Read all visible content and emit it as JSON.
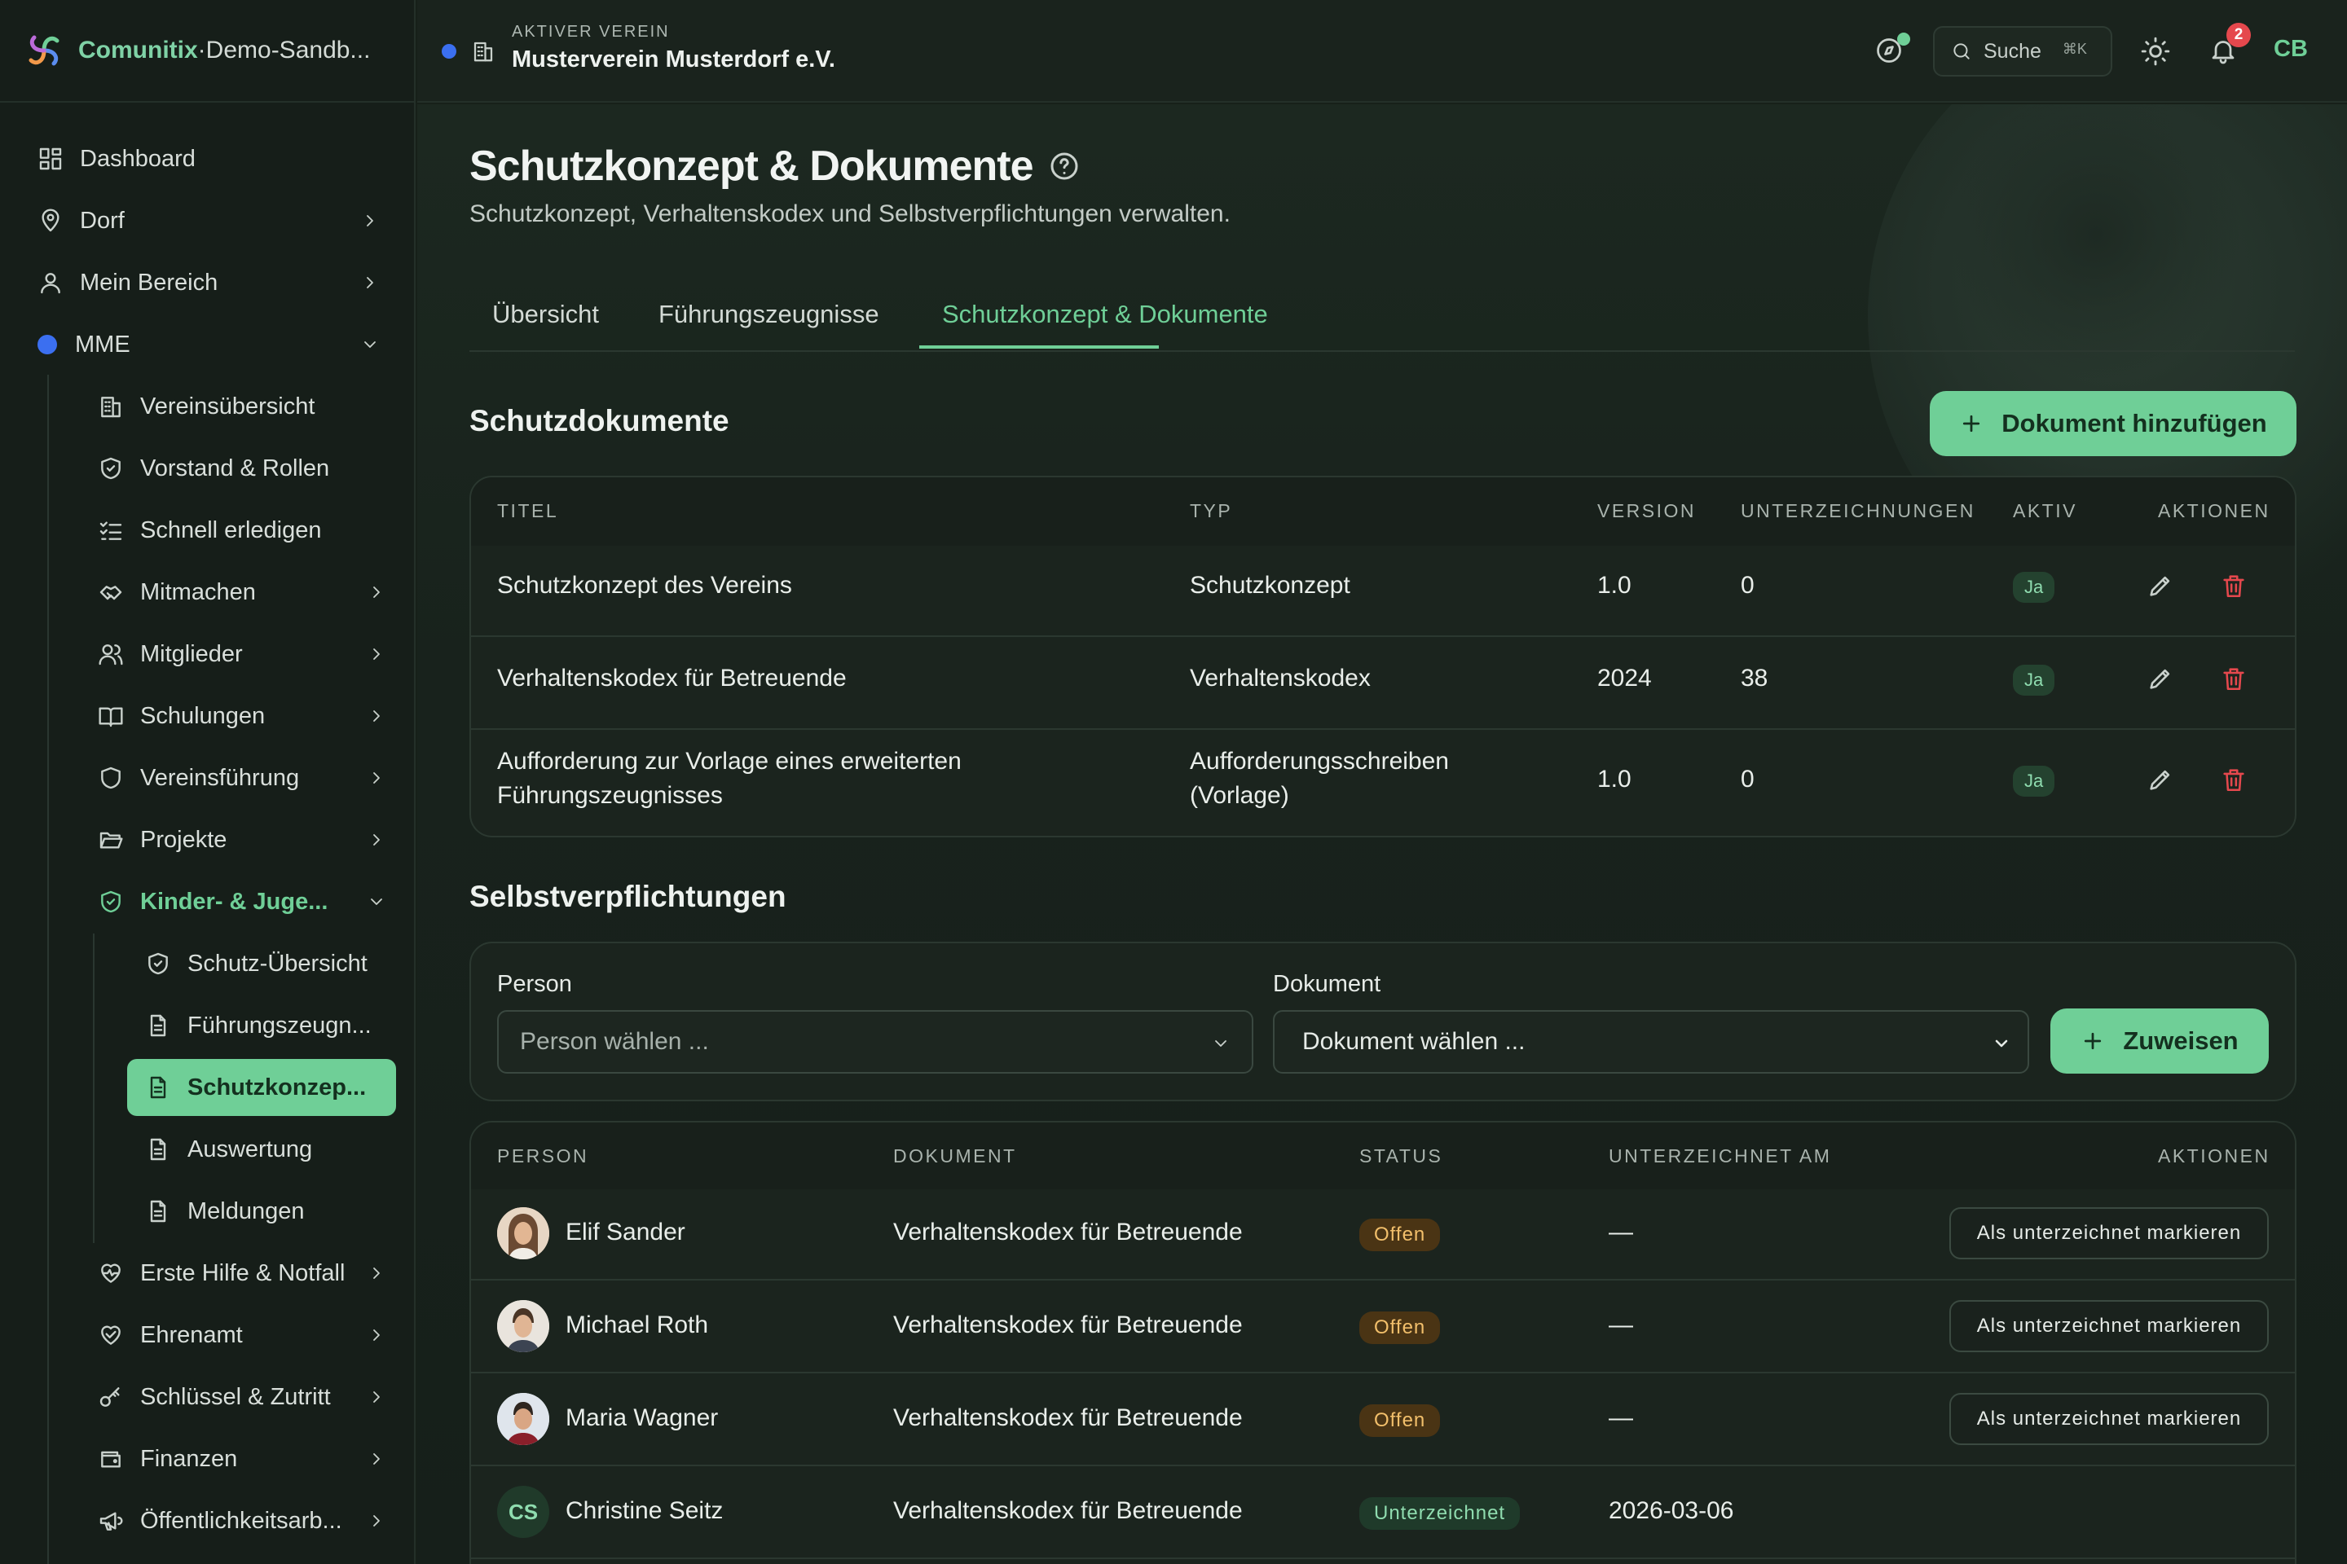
{
  "brand": {
    "name": "Comunitix",
    "separator": " · ",
    "sandbox": "Demo-Sandb..."
  },
  "topbar": {
    "org_label": "AKTIVER VEREIN",
    "org_name": "Musterverein Musterdorf e.V.",
    "search_label": "Suche",
    "search_shortcut": "⌘K",
    "notification_count": "2",
    "user_initials": "CB"
  },
  "sidebar": {
    "items": [
      {
        "label": "Dashboard"
      },
      {
        "label": "Dorf"
      },
      {
        "label": "Mein Bereich"
      },
      {
        "label": "MME"
      },
      {
        "label": "Vereinsübersicht"
      },
      {
        "label": "Vorstand & Rollen"
      },
      {
        "label": "Schnell erledigen"
      },
      {
        "label": "Mitmachen"
      },
      {
        "label": "Mitglieder"
      },
      {
        "label": "Schulungen"
      },
      {
        "label": "Vereinsführung"
      },
      {
        "label": "Projekte"
      },
      {
        "label": "Kinder- & Juge..."
      },
      {
        "label": "Schutz-Übersicht"
      },
      {
        "label": "Führungszeugn..."
      },
      {
        "label": "Schutzkonzep..."
      },
      {
        "label": "Auswertung"
      },
      {
        "label": "Meldungen"
      },
      {
        "label": "Erste Hilfe & Notfall"
      },
      {
        "label": "Ehrenamt"
      },
      {
        "label": "Schlüssel & Zutritt"
      },
      {
        "label": "Finanzen"
      },
      {
        "label": "Öffentlichkeitsarb..."
      }
    ]
  },
  "page": {
    "title": "Schutzkonzept & Dokumente",
    "subtitle": "Schutzkonzept, Verhaltenskodex und Selbstverpflichtungen verwalten.",
    "tabs": [
      {
        "label": "Übersicht"
      },
      {
        "label": "Führungszeugnisse"
      },
      {
        "label": "Schutzkonzept & Dokumente"
      }
    ]
  },
  "documents": {
    "heading": "Schutzdokumente",
    "add_button": "Dokument hinzufügen",
    "columns": [
      "TITEL",
      "TYP",
      "VERSION",
      "UNTERZEICHNUNGEN",
      "AKTIV",
      "AKTIONEN"
    ],
    "rows": [
      {
        "title": "Schutzkonzept des Vereins",
        "type": "Schutzkonzept",
        "version": "1.0",
        "signatures": "0",
        "active": "Ja"
      },
      {
        "title": "Verhaltenskodex für Betreuende",
        "type": "Verhaltenskodex",
        "version": "2024",
        "signatures": "38",
        "active": "Ja"
      },
      {
        "title": "Aufforderung zur Vorlage eines erweiterten Führungszeugnisses",
        "title_l1": "Aufforderung zur Vorlage eines erweiterten",
        "title_l2": "Führungszeugnisses",
        "type_l1": "Aufforderungsschreiben",
        "type_l2": "(Vorlage)",
        "version": "1.0",
        "signatures": "0",
        "active": "Ja"
      }
    ]
  },
  "commitments": {
    "heading": "Selbstverpflichtungen",
    "person_label": "Person",
    "person_placeholder": "Person wählen ...",
    "document_label": "Dokument",
    "document_placeholder": "Dokument wählen ...",
    "assign_button": "Zuweisen",
    "columns": [
      "PERSON",
      "DOKUMENT",
      "STATUS",
      "UNTERZEICHNET AM",
      "AKTIONEN"
    ],
    "rows": [
      {
        "name": "Elif Sander",
        "document": "Verhaltenskodex für Betreuende",
        "status": "Offen",
        "signed_at": "—",
        "action": "Als unterzeichnet markieren"
      },
      {
        "name": "Michael Roth",
        "document": "Verhaltenskodex für Betreuende",
        "status": "Offen",
        "signed_at": "—",
        "action": "Als unterzeichnet markieren"
      },
      {
        "name": "Maria Wagner",
        "document": "Verhaltenskodex für Betreuende",
        "status": "Offen",
        "signed_at": "—",
        "action": "Als unterzeichnet markieren"
      },
      {
        "name": "Christine Seitz",
        "initials": "CS",
        "document": "Verhaltenskodex für Betreuende",
        "status": "Unterzeichnet",
        "signed_at": "2026-03-06"
      }
    ]
  },
  "colors": {
    "accent": "#6fcf97",
    "accent_text": "#14301f",
    "danger": "#e5484d",
    "warning": "#f2bf6b"
  }
}
